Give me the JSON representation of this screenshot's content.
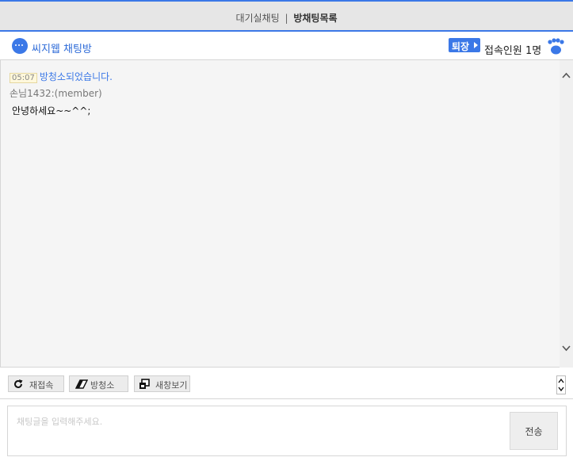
{
  "topbar": {
    "tab_waiting": "대기실채팅",
    "separator": "|",
    "tab_rooms": "방채팅목록"
  },
  "header": {
    "room_name": "씨지웹 채팅방",
    "exit_label": "퇴장",
    "users_label": "접속인원 1명",
    "icons": {
      "room": "chat-bubble-icon",
      "users": "users-group-icon"
    }
  },
  "chat": {
    "messages": [
      {
        "type": "system",
        "time": "05:07",
        "text": "방청소되었습니다."
      },
      {
        "type": "user",
        "sender": "손님1432:(member)",
        "text": "안녕하세요~~^^;"
      }
    ]
  },
  "toolbar": {
    "reconnect_label": "재접속",
    "clear_label": "방청소",
    "newwin_label": "새창보기"
  },
  "composer": {
    "placeholder": "채팅글을 입력해주세요.",
    "send_label": "전송"
  },
  "colors": {
    "accent": "#3b78e7",
    "system_text": "#3b78e7",
    "chat_bg": "#f5f5f5"
  }
}
